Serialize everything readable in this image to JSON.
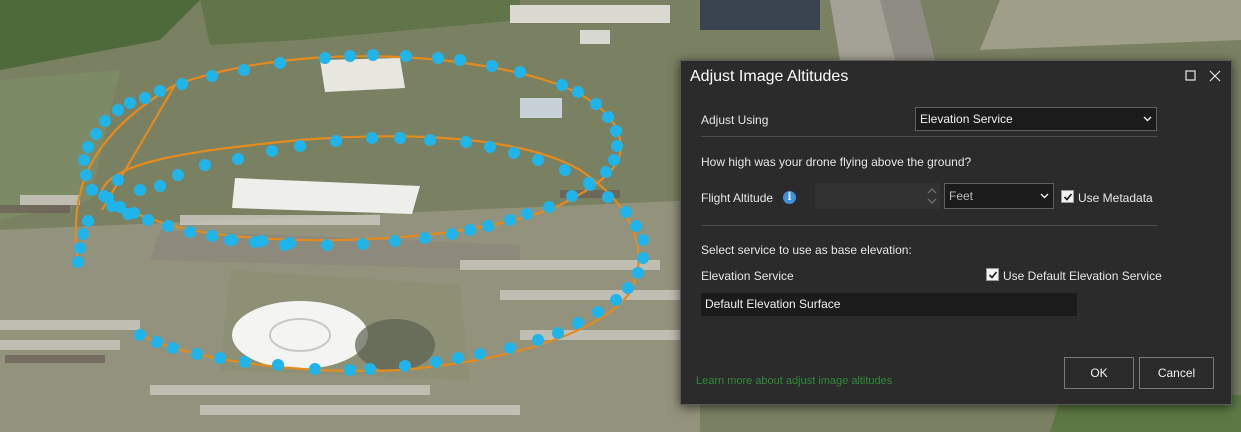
{
  "dialog": {
    "title": "Adjust Image Altitudes",
    "adjust_using": {
      "label": "Adjust Using",
      "value": "Elevation Service"
    },
    "question": "How high was your drone flying above the ground?",
    "flight_altitude": {
      "label": "Flight Altitude",
      "value": "",
      "unit": "Feet",
      "use_metadata_label": "Use Metadata",
      "use_metadata_checked": true
    },
    "base_elevation_prompt": "Select service to use as base elevation:",
    "elevation_service": {
      "label": "Elevation Service",
      "use_default_label": "Use Default Elevation Service",
      "use_default_checked": true,
      "value": "Default Elevation Surface"
    },
    "learn_more_link": "Learn more about adjust image altitudes",
    "ok_label": "OK",
    "cancel_label": "Cancel",
    "icons": [
      "maximize-icon",
      "close-icon",
      "info-icon",
      "chevron-down-icon",
      "spin-arrows-icon",
      "checkmark-icon"
    ]
  },
  "colors": {
    "waypoint": "#1fb4ea",
    "flight_path": "#e58a1c",
    "dialog_bg": "#2b2b2b",
    "link": "#2f8a3a"
  }
}
